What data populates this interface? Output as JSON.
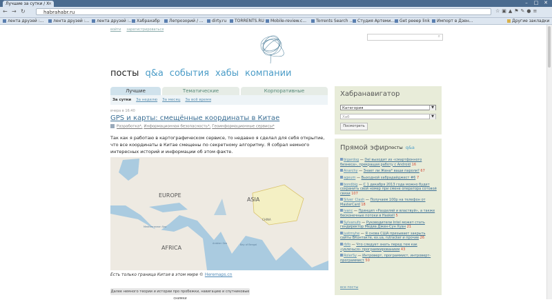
{
  "browser": {
    "tab_title": "Лучшие за сутки / Х",
    "url": "habrahabr.ru",
    "bookmarks": [
      "лента друзей :...",
      "лента друзей :...",
      "лента друзей :...",
      "Хабрахабр",
      "Лепрозорий / ...",
      "dirty.ru",
      "TORRENTS.RU",
      "Mobile-review.c...",
      "Torrents Search ...",
      "Студия Артеми...",
      "Get peeep link",
      "Импорт в Дзен..."
    ],
    "other_bookmarks": "Другие закладки"
  },
  "page": {
    "login": "войти",
    "register": "зарегистрироваться",
    "nav": [
      "посты",
      "q&a",
      "события",
      "хабы",
      "компании"
    ],
    "tabs": [
      "Лучшие",
      "Тематические",
      "Корпоративные"
    ],
    "subtabs": [
      "За сутки",
      "За неделю",
      "За месяц",
      "За всё время"
    ],
    "post": {
      "date": "вчера в 16:40",
      "title": "GPS и карты: смещённые координаты в Китае",
      "hubs": [
        "Разработка*,",
        "Информационная безопасность*,",
        "Геоинформационные сервисы*"
      ],
      "text": "Так как я работаю в картографическом сервисе, то недавно я сделал для себя открытие, что все координаты в Китае смещены по секретному алгоритму. Я собрал немного интересных историй и информации об этом факте.",
      "map_labels": [
        "EUROPE",
        "ASIA",
        "AFRICA",
        "CHINA",
        "Mediterranean Sea",
        "Arabian Sea",
        "Bay of Bengal"
      ],
      "caption": "Есть только граница Китая в этом мире ©",
      "caption_link": "Heremaps.cn",
      "readmore": "Далее немного теории и истории про пробежки, навигацию и спутниковые снимки"
    }
  },
  "sidebar": {
    "hn_title": "Хабранавигатор",
    "select1": "Категория",
    "select2": "Хаб",
    "show_button": "Посмотреть",
    "live_title": "Прямой эфир",
    "live_tabs": [
      "посты",
      "q&a"
    ],
    "feed": [
      {
        "user": "bigardog",
        "title": "DeI выходит из «смартфонного бизнеса», прекращая работу с Android",
        "count": "16"
      },
      {
        "user": "Anarchy",
        "title": "Знает ли Жена* ваши пароли?",
        "count": "67"
      },
      {
        "user": "ageum",
        "title": "Выходной хабрадайджест #6",
        "count": "7"
      },
      {
        "user": "bondbig",
        "title": "С 1 декабря 2013 года можно будет сохранить свой номер при смене оператора сотовой связи",
        "count": "107"
      },
      {
        "user": "Silver_Clash",
        "title": "Получаем 100р на телефон от MasterCard",
        "count": "18"
      },
      {
        "user": "ivanc",
        "title": "Принцип «Разделяй и властвуй», а также бесконечные потоки в Haskell",
        "count": "5"
      },
      {
        "user": "Sylvanufo",
        "title": "Руководители Intel может стать гендиректор Медиа Джен-Сун Хуан",
        "count": "21"
      },
      {
        "user": "justmyhe",
        "title": "Я снова США призывает закрыть сайты ВКонтакте, ex.ua, rutracker и прочие",
        "count": "26"
      },
      {
        "user": "rbfo",
        "title": "Что следует знать перед тем как «увлечься» программированием",
        "count": "43"
      },
      {
        "user": "RolerSy",
        "title": "Интроверт, программист, интроверт-программист",
        "count": "50"
      }
    ],
    "all_posts": "все посты"
  }
}
